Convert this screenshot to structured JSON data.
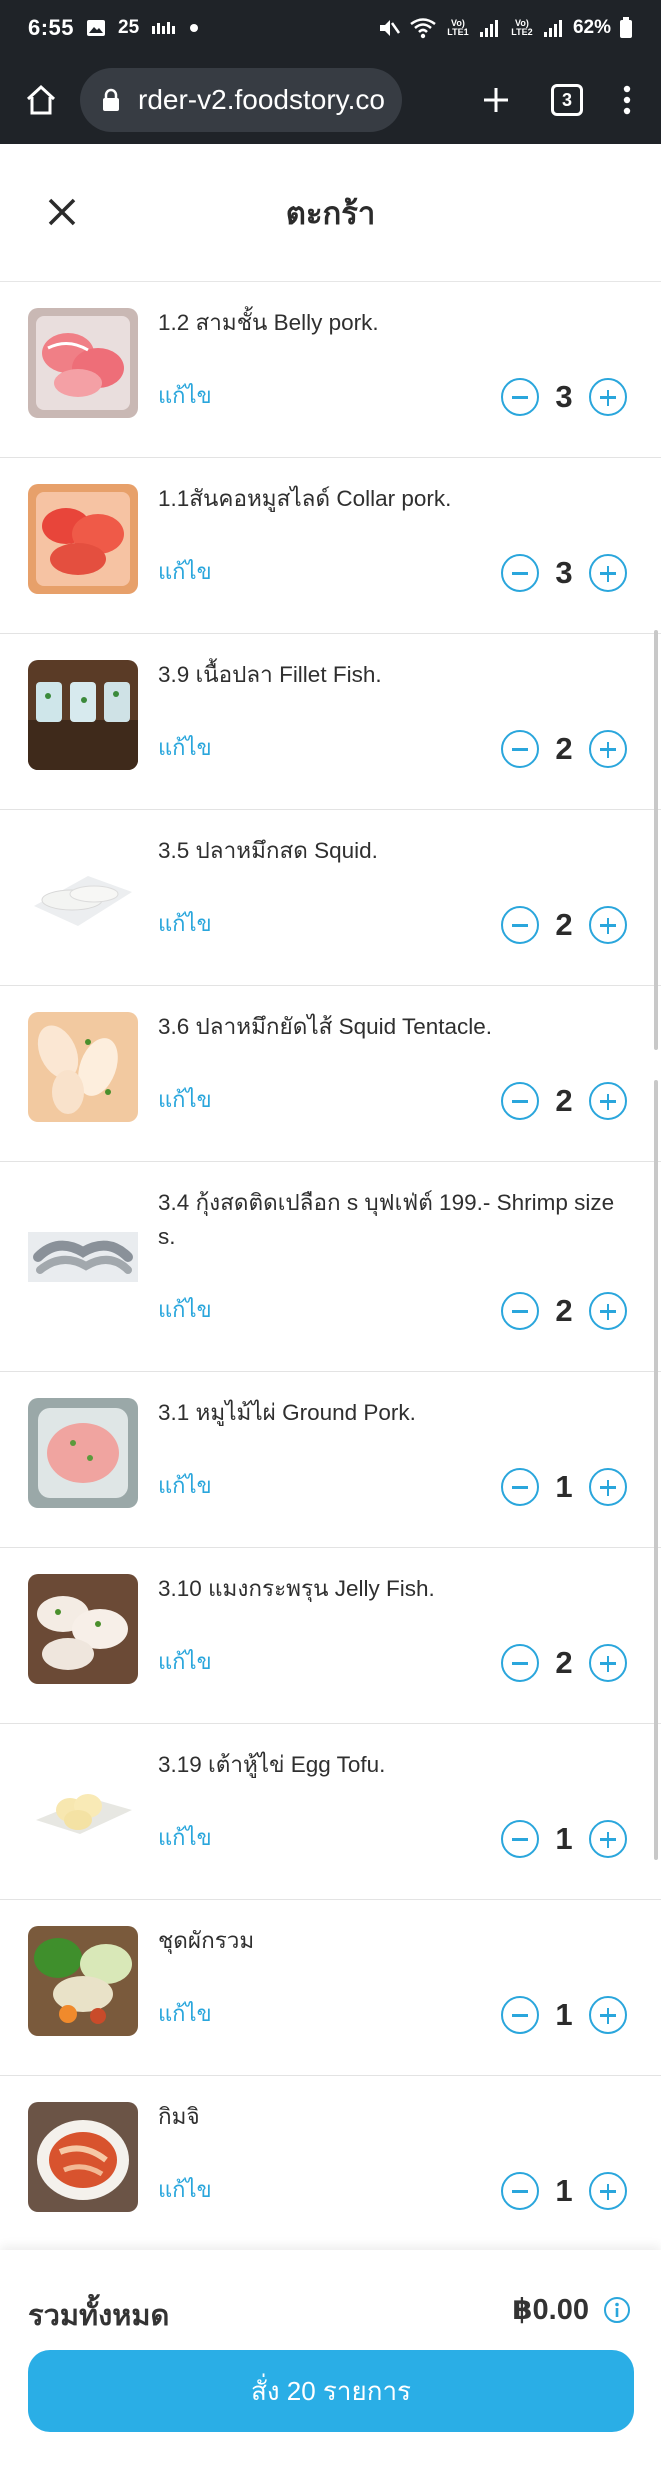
{
  "status_bar": {
    "time": "6:55",
    "notification_count": "25",
    "battery": "62%",
    "lte1": "Vo) LTE1",
    "lte2": "Vo) LTE2"
  },
  "browser": {
    "url": "rder-v2.foodstory.co",
    "tab_count": "3"
  },
  "header": {
    "title": "ตะกร้า"
  },
  "edit_label": "แก้ไข",
  "cart_items": [
    {
      "name": "1.2 สามชั้น Belly pork.",
      "qty": "3",
      "image": "belly-pork"
    },
    {
      "name": "1.1สันคอหมูสไลด์ Collar pork.",
      "qty": "3",
      "image": "collar-pork"
    },
    {
      "name": "3.9 เนื้อปลา Fillet Fish.",
      "qty": "2",
      "image": "fillet-fish"
    },
    {
      "name": "3.5 ปลาหมึกสด Squid.",
      "qty": "2",
      "image": "squid"
    },
    {
      "name": "3.6 ปลาหมึกยัดไส้ Squid Tentacle.",
      "qty": "2",
      "image": "squid-tentacle"
    },
    {
      "name": "3.4 กุ้งสดติดเปลือก s บุฟเฟ่ต์ 199.- Shrimp size s.",
      "qty": "2",
      "image": "shrimp"
    },
    {
      "name": "3.1 หมูไม้ไผ่ Ground Pork.",
      "qty": "1",
      "image": "ground-pork"
    },
    {
      "name": "3.10 แมงกระพรุน Jelly Fish.",
      "qty": "2",
      "image": "jelly-fish"
    },
    {
      "name": "3.19 เต้าหู้ไข่ Egg Tofu.",
      "qty": "1",
      "image": "egg-tofu"
    },
    {
      "name": "ชุดผักรวม",
      "qty": "1",
      "image": "vegetable-set"
    },
    {
      "name": "กิมจิ",
      "qty": "1",
      "image": "kimchi"
    }
  ],
  "footer": {
    "total_label": "รวมทั้งหมด",
    "total_value": "฿0.00",
    "order_button": "สั่ง 20 รายการ"
  },
  "colors": {
    "accent": "#2aa6dc",
    "order_button": "#2aaee6",
    "status_bar": "#1f2328"
  }
}
